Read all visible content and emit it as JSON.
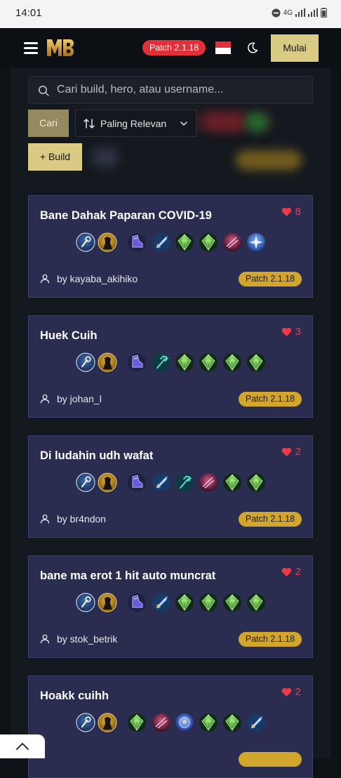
{
  "status_bar": {
    "time": "14:01",
    "network": "4G"
  },
  "header": {
    "logo_text": "MB",
    "patch_badge": "Patch 2.1.18",
    "mulai_label": "Mulai",
    "icons": [
      "menu-icon",
      "indonesia-flag-icon",
      "moon-icon"
    ]
  },
  "search": {
    "placeholder": "Cari build, hero, atau username..."
  },
  "controls": {
    "cari_label": "Cari",
    "sort_label": "Paling Relevan",
    "add_build_label": "+ Build"
  },
  "colors": {
    "accent": "#d9cb83",
    "danger": "#e0313b",
    "card_bg": "#2a2d4f",
    "patch_chip": "#d2a52d"
  },
  "builds": [
    {
      "title": "Bane Dahak Paparan COVID-19",
      "likes": "8",
      "author": "by kayaba_akihiko",
      "patch": "Patch 2.1.18",
      "items": [
        "spell-icon",
        "hero-icon",
        "boots-icon",
        "blade-icon",
        "emerald-icon",
        "emerald-icon",
        "crimson-orb-icon",
        "ice-crystal-icon"
      ]
    },
    {
      "title": "Huek Cuih",
      "likes": "3",
      "author": "by johan_l",
      "patch": "Patch 2.1.18",
      "items": [
        "spell-icon",
        "hero-icon",
        "boots-icon",
        "trident-icon",
        "emerald-icon",
        "emerald-icon",
        "emerald-icon",
        "emerald-icon"
      ]
    },
    {
      "title": "Di ludahin udh wafat",
      "likes": "2",
      "author": "by br4ndon",
      "patch": "Patch 2.1.18",
      "items": [
        "spell-icon",
        "hero-icon",
        "boots-icon",
        "blade-icon",
        "trident-icon",
        "crimson-orb-icon",
        "emerald-icon",
        "emerald-icon"
      ]
    },
    {
      "title": "bane ma erot 1 hit auto muncrat",
      "likes": "2",
      "author": "by stok_betrik",
      "patch": "Patch 2.1.18",
      "items": [
        "spell-icon",
        "hero-icon",
        "boots-icon",
        "blade-icon",
        "emerald-icon",
        "emerald-icon",
        "emerald-icon",
        "emerald-icon"
      ]
    },
    {
      "title": "Hoakk cuihh",
      "likes": "2",
      "author": "",
      "patch": "",
      "items": [
        "spell-icon",
        "hero-icon",
        "emerald-icon",
        "crimson-orb-icon",
        "orb-icon",
        "emerald-icon",
        "emerald-icon",
        "blade-icon"
      ]
    }
  ]
}
